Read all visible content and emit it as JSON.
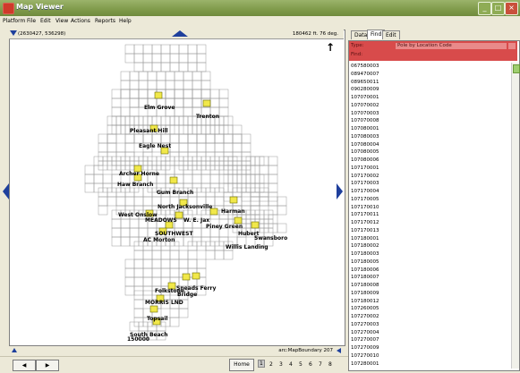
{
  "window": {
    "title": "Map Viewer",
    "min": "_",
    "max": "□",
    "close": "×"
  },
  "menu": [
    "Platform",
    "File",
    "Edit",
    "View",
    "Actions",
    "Reports",
    "Help"
  ],
  "map": {
    "coords": "(2630427, 536298)",
    "scale_readout": "180462 ft. 76 deg.",
    "layer": "arc:MapBoundary 207",
    "scale_label": "150000",
    "north": "↑",
    "cities": [
      "Elm Grove",
      "Trenton",
      "Pleasant Hill",
      "Eagle Nest",
      "Archer Horne",
      "Haw Branch",
      "Gum Branch",
      "North Jacksonville",
      "Harman",
      "West Onslow",
      "MEADOWS",
      "W. E. Jax",
      "Piney Green",
      "Hubert",
      "Swansboro",
      "SOUTHWEST",
      "AC Morton",
      "Willis Landing",
      "Folkstone",
      "Sneads Ferry",
      "Bridge",
      "MORRIS LND",
      "Topsail",
      "South Beach"
    ]
  },
  "bottom": {
    "back": "◀",
    "forward": "▶",
    "home": "Home",
    "pages": [
      "1",
      "2",
      "3",
      "4",
      "5",
      "6",
      "7",
      "8"
    ]
  },
  "right_panel": {
    "tabs": [
      "Data",
      "Find",
      "Edit"
    ],
    "type_label": "Type:",
    "type_value": "Pole by Location Code",
    "find_label": "Find:",
    "items": [
      "067580003",
      "089470007",
      "089650011",
      "090280009",
      "107070001",
      "107070002",
      "107070003",
      "107070008",
      "107080001",
      "107080003",
      "107080004",
      "107080005",
      "107080006",
      "107170001",
      "107170002",
      "107170003",
      "107170004",
      "107170005",
      "107170010",
      "107170011",
      "107170012",
      "107170013",
      "107180001",
      "107180002",
      "107180003",
      "107180005",
      "107180006",
      "107180007",
      "107180008",
      "107180009",
      "107180012",
      "107260005",
      "107270002",
      "107270003",
      "107270004",
      "107270007",
      "107270009",
      "107270010",
      "107280001"
    ]
  },
  "colors": {
    "titlebar": "#7f9a4a",
    "nav_arrow": "#1e3f9c",
    "find_header": "#d84b4b",
    "pole_marker": "#f1e84a"
  }
}
